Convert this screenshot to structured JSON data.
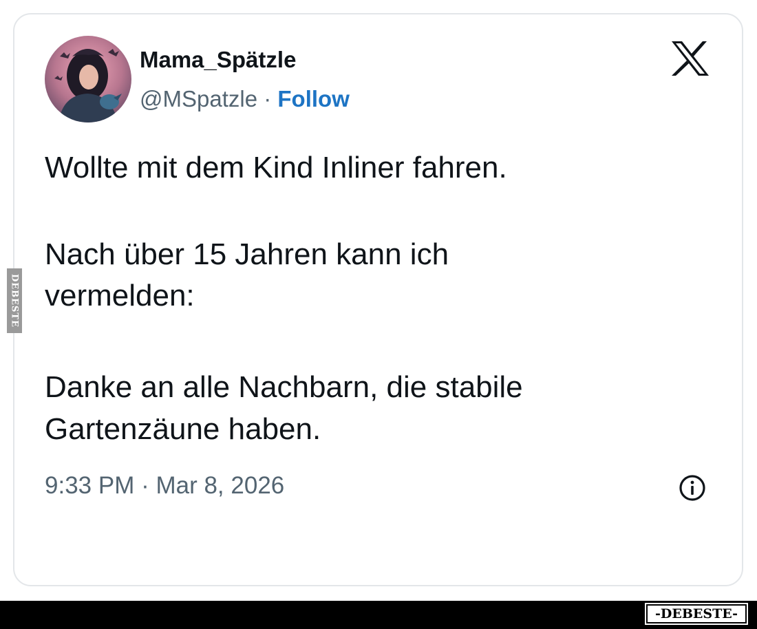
{
  "tweet": {
    "display_name": "Mama_Spätzle",
    "handle": "@MSpatzle",
    "separator": " · ",
    "follow_label": "Follow",
    "lines": [
      "Wollte mit dem Kind Inliner fahren.",
      "Nach über 15 Jahren kann ich",
      "vermelden:",
      "Danke an alle Nachbarn, die stabile",
      "Gartenzäune haben."
    ],
    "time": "9:33 PM",
    "meta_separator": " · ",
    "date": "Mar 8, 2026"
  },
  "watermarks": {
    "side": "DEBESTE",
    "footer": "-DEBESTE-"
  },
  "icons": {
    "brand": "x-logo-icon",
    "info": "info-icon"
  },
  "colors": {
    "text": "#0f1419",
    "secondary": "#536471",
    "follow": "#1d74c4",
    "card_border": "#e3e6e9"
  }
}
